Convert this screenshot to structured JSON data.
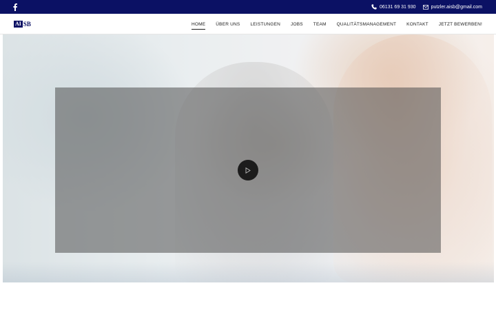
{
  "topbar": {
    "background": "#0b1164",
    "social_icon": "facebook-icon",
    "phone": "06131 69 31 930",
    "phone_icon": "phone-icon",
    "email": "putzler.aisb@gmail.com",
    "email_icon": "envelope-icon"
  },
  "logo": {
    "box_text": "AI",
    "rest_text": "SB"
  },
  "nav": {
    "items": [
      {
        "label": "HOME",
        "active": true
      },
      {
        "label": "ÜBER UNS"
      },
      {
        "label": "LEISTUNGEN"
      },
      {
        "label": "JOBS"
      },
      {
        "label": "TEAM"
      },
      {
        "label": "QUALITÄTSMANAGEMENT"
      },
      {
        "label": "KONTAKT"
      },
      {
        "label": "JETZT BEWERBEN!"
      }
    ]
  },
  "hero": {
    "play_icon": "play-icon",
    "overlay_color": "#505050"
  }
}
